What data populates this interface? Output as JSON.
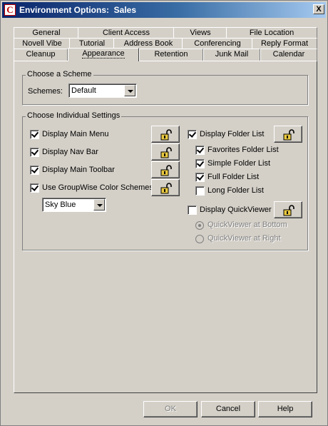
{
  "window": {
    "title": "Environment Options:  Sales",
    "icon_letter": "C",
    "close_glyph": "X"
  },
  "tabs": {
    "row1": [
      "General",
      "Client Access",
      "Views",
      "File Location"
    ],
    "row2": [
      "Novell Vibe",
      "Tutorial",
      "Address Book",
      "Conferencing",
      "Reply Format"
    ],
    "row3": [
      "Cleanup",
      "Appearance",
      "Retention",
      "Junk Mail",
      "Calendar"
    ],
    "active": "Appearance"
  },
  "scheme": {
    "group_title": "Choose a Scheme",
    "label": "Schemes:",
    "value": "Default"
  },
  "settings": {
    "group_title": "Choose Individual Settings",
    "left": [
      {
        "label": "Display Main Menu",
        "checked": true
      },
      {
        "label": "Display Nav Bar",
        "checked": true
      },
      {
        "label": "Display Main Toolbar",
        "checked": true
      },
      {
        "label": "Use GroupWise Color Schemes",
        "checked": true
      }
    ],
    "color_scheme": "Sky Blue",
    "folder_list": {
      "label": "Display Folder List",
      "checked": true
    },
    "folder_options": [
      {
        "label": "Favorites Folder List",
        "checked": true
      },
      {
        "label": "Simple Folder List",
        "checked": true
      },
      {
        "label": "Full Folder List",
        "checked": true
      },
      {
        "label": "Long Folder List",
        "checked": false
      }
    ],
    "quickviewer": {
      "label": "Display QuickViewer",
      "checked": false
    },
    "quickviewer_options": [
      {
        "label": "QuickViewer at Bottom",
        "selected": true,
        "enabled": false
      },
      {
        "label": "QuickViewer at Right",
        "selected": false,
        "enabled": false
      }
    ]
  },
  "buttons": {
    "ok": "OK",
    "cancel": "Cancel",
    "help": "Help"
  },
  "colors": {
    "titlebar_start": "#0a246a",
    "titlebar_end": "#a6caf0",
    "dialog_face": "#d4d0c8",
    "lock_icon": "#e8c840"
  }
}
